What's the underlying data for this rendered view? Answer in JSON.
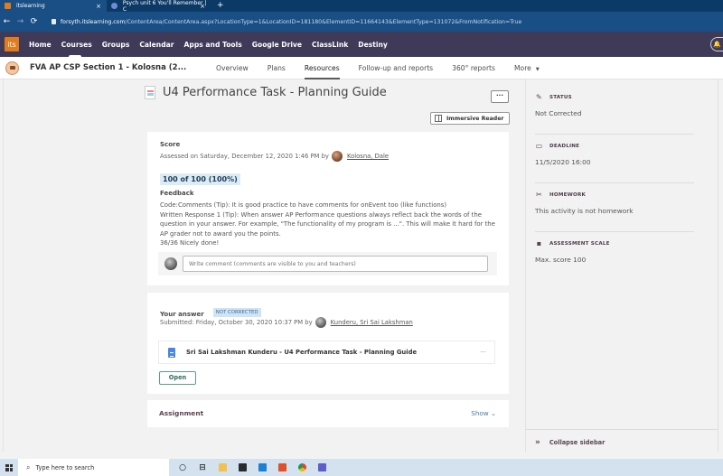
{
  "browser": {
    "tabs": [
      {
        "label": "itslearning",
        "active": true
      },
      {
        "label": "Psych unit 6 You'll Remember | C",
        "active": false
      }
    ],
    "new_tab": "+",
    "close": "×",
    "url_host": "forsyth.itslearning.com",
    "url_path": "/ContentArea/ContentArea.aspx?LocationType=1&LocationID=181180&ElementID=11664143&ElementType=131072&FromNotification=True"
  },
  "topnav": {
    "logo": "its",
    "items": [
      "Home",
      "Courses",
      "Groups",
      "Calendar",
      "Apps and Tools",
      "Google Drive",
      "ClassLink",
      "Destiny"
    ],
    "current": "Courses"
  },
  "course": {
    "title": "FVA AP CSP Section 1 - Kolosna (2...",
    "tabs": [
      "Overview",
      "Plans",
      "Resources",
      "Follow-up and reports",
      "360° reports",
      "More"
    ],
    "active_tab": "Resources"
  },
  "page": {
    "title": "U4 Performance Task - Planning Guide",
    "more_button": "···",
    "immersive_reader": "Immersive Reader"
  },
  "score": {
    "heading": "Score",
    "assessed_prefix": "Assessed on Saturday, December 12, 2020 1:46 PM by",
    "assessor": "Kolosna, Dale",
    "value": "100 of 100 (100%)",
    "feedback_heading": "Feedback",
    "feedback_lines": [
      "Code:Comments (Tip): It is good practice to have comments for onEvent too (like functions)",
      "Written Response 1 (Tip): When answer AP Performance questions always reflect back the words of the question in your answer. For example, \"The functionality of my program is ...\". This will make it hard for the AP grader not to award you the points.",
      "36/36 Nicely done!"
    ],
    "comment_placeholder": "Write comment (comments are visible to you and teachers)"
  },
  "answer": {
    "heading": "Your answer",
    "badge": "NOT CORRECTED",
    "submitted_prefix": "Submitted: Friday, October 30, 2020 10:37 PM by",
    "submitter": "Kunderu, Sri Sai Lakshman",
    "file_name": "Sri Sai Lakshman Kunderu - U4 Performance Task - Planning Guide",
    "file_more": "···",
    "open_label": "Open"
  },
  "assignment": {
    "heading": "Assignment",
    "show_label": "Show"
  },
  "sidebar": {
    "sections": [
      {
        "icon": "pencil-icon",
        "label": "STATUS",
        "value": "Not Corrected"
      },
      {
        "icon": "calendar-icon",
        "label": "DEADLINE",
        "value": "11/5/2020 16:00"
      },
      {
        "icon": "homework-icon",
        "label": "HOMEWORK",
        "value": "This activity is not homework"
      },
      {
        "icon": "assessment-scale-icon",
        "label": "ASSESSMENT SCALE",
        "value": "Max. score 100"
      }
    ],
    "collapse_label": "Collapse sidebar"
  },
  "taskbar": {
    "search_placeholder": "Type here to search",
    "apps": [
      "cortana",
      "task-view",
      "file-explorer",
      "microsoft-store",
      "mail",
      "office",
      "chrome",
      "teams"
    ]
  },
  "colors": {
    "topnav_bg": "#3e3a57",
    "logo_orange": "#e07b1f",
    "browser_blue": "#1a4f86",
    "badge_blue": "#cfe5f7",
    "open_green": "#5a9e8a"
  }
}
